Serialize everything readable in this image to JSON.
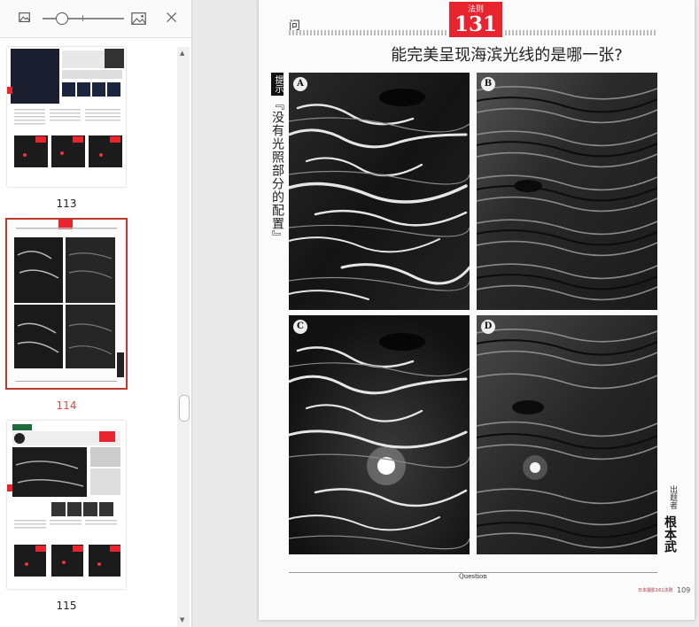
{
  "toolbar": {
    "icons": [
      "image-small-icon",
      "zoom-slider",
      "image-large-icon",
      "close-icon"
    ]
  },
  "thumbnails": [
    {
      "label": "113"
    },
    {
      "label": "114",
      "selected": true,
      "badge": "131",
      "title": "能完美呈现海滨光线的是哪一张?"
    },
    {
      "label": "115",
      "title": "导致曝光异常出现的影子,光照度过于明亮",
      "score": "100"
    }
  ],
  "page": {
    "question_char": "问",
    "badge_small": "法则",
    "badge_number": "131",
    "headline": "能完美呈现海滨光线的是哪一张?",
    "hint_label": "提示",
    "hint_text": "『没有光照部分的配置』",
    "photo_labels": [
      "A",
      "B",
      "C",
      "D"
    ],
    "setter_label": "出题者",
    "setter_name": "根本武",
    "question_footer": "Question",
    "footer_small": "日本摄影161法则",
    "page_number": "109"
  },
  "colors": {
    "accent_red": "#e8242e",
    "selected_outline": "#c0392b"
  }
}
